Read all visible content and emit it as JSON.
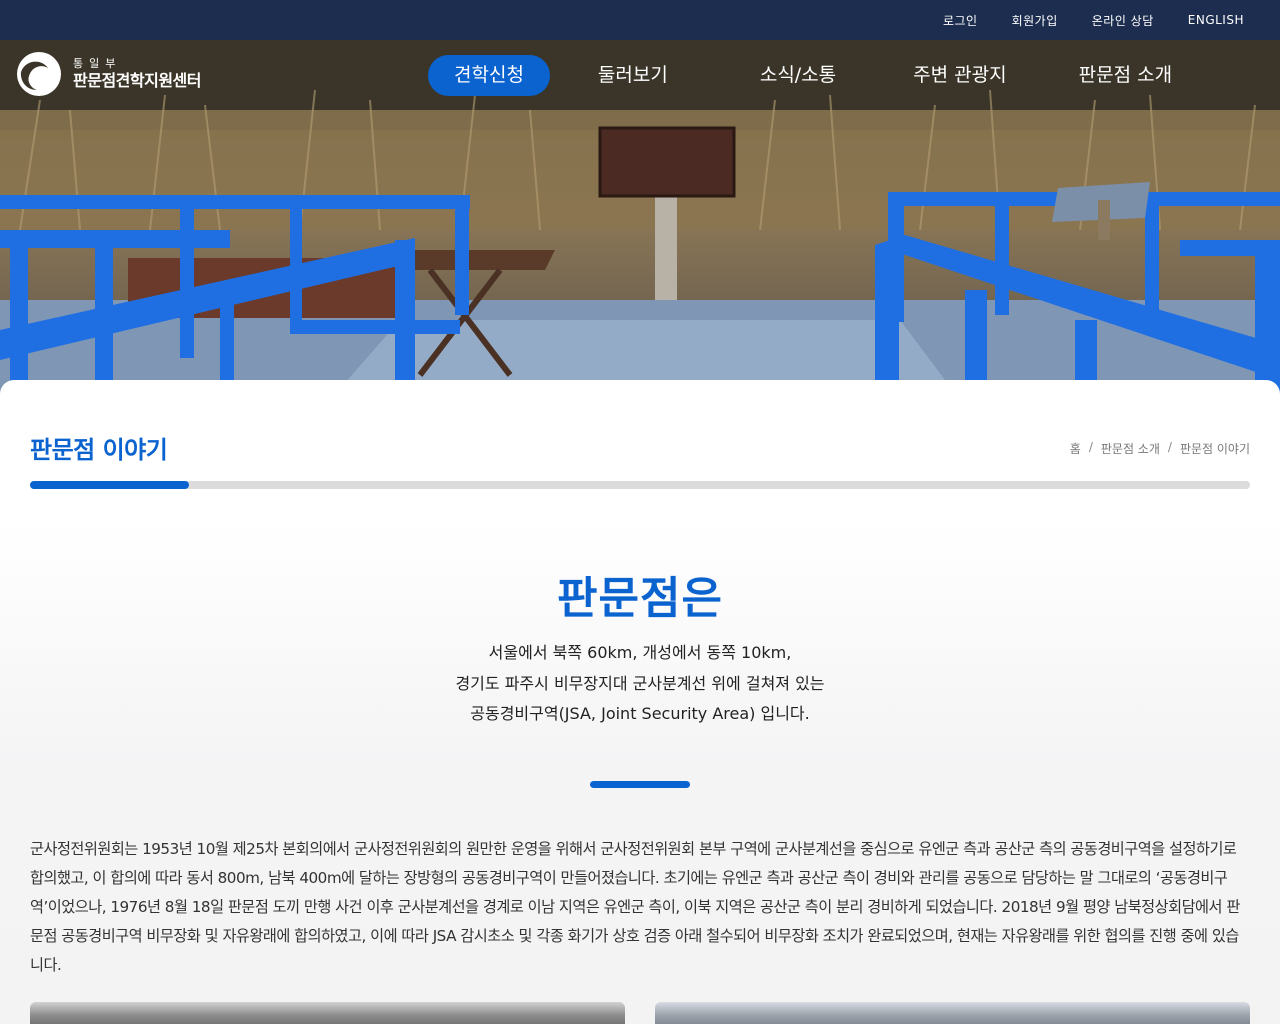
{
  "topbar": {
    "links": [
      {
        "label": "로그인"
      },
      {
        "label": "회원가입"
      },
      {
        "label": "온라인 상담"
      },
      {
        "label": "ENGLISH"
      }
    ]
  },
  "logo": {
    "ministry": "통일부",
    "name": "판문점견학지원센터"
  },
  "nav": {
    "items": [
      {
        "label": "견학신청",
        "active": true
      },
      {
        "label": "둘러보기",
        "active": false
      },
      {
        "label": "소식/소통",
        "active": false
      },
      {
        "label": "주변 관광지",
        "active": false
      },
      {
        "label": "판문점 소개",
        "active": false
      }
    ]
  },
  "page": {
    "title": "판문점 이야기",
    "breadcrumb": [
      "홈",
      "판문점 소개",
      "판문점 이야기"
    ],
    "progress_fraction": 0.13
  },
  "intro": {
    "heading": "판문점은",
    "lines": [
      "서울에서 북쪽 60km, 개성에서 동쪽 10km,",
      "경기도 파주시 비무장지대 군사분계선 위에 걸쳐져 있는",
      "공동경비구역(JSA, Joint Security Area) 입니다."
    ]
  },
  "body": {
    "paragraph": "군사정전위원회는 1953년 10월 제25차 본회의에서 군사정전위원회의 원만한 운영을 위해서 군사정전위원회 본부 구역에 군사분계선을 중심으로 유엔군 측과 공산군 측의 공동경비구역을 설정하기로 합의했고, 이 합의에 따라 동서 800m, 남북 400m에 달하는 장방형의 공동경비구역이 만들어졌습니다. 초기에는 유엔군 측과 공산군 측이 경비와 관리를 공동으로 담당하는 말 그대로의 ‘공동경비구역’이었으나, 1976년 8월 18일 판문점 도끼 만행 사건 이후 군사분계선을 경계로 이남 지역은 유엔군 측이, 이북 지역은 공산군 측이 분리 경비하게 되었습니다. 2018년 9월 평양 남북정상회담에서 판문점 공동경비구역 비무장화 및 자유왕래에 합의하였고, 이에 따라 JSA 감시초소 및 각종 화기가 상호 검증 아래 철수되어 비무장화 조치가 완료되었으며, 현재는 자유왕래를 위한 협의를 진행 중에 있습니다."
  },
  "colors": {
    "accent": "#0b63d0",
    "topbar": "#1c2d4f",
    "track": "#dcdcdc"
  }
}
